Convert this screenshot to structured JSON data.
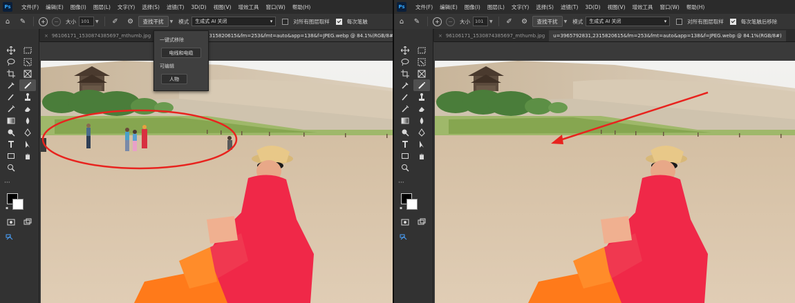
{
  "menu": {
    "app_icon": "Ps",
    "items": [
      "文件(F)",
      "编辑(E)",
      "图像(I)",
      "图层(L)",
      "文字(Y)",
      "选择(S)",
      "滤镜(T)",
      "3D(D)",
      "视图(V)",
      "增效工具",
      "窗口(W)",
      "帮助(H)"
    ]
  },
  "options": {
    "size_label": "大小",
    "size_value": "101",
    "find_button": "查找干扰",
    "mode_label": "模式",
    "mode_value": "生成式 AI 关闭",
    "sample_all_label": "对所有图层取样",
    "stroke_label": "每次笔触后移除",
    "stroke_label_short": "每次笔触"
  },
  "dropdown": {
    "heading1": "一键式移除",
    "button1": "电线和电缆",
    "heading2": "可编辑",
    "button2": "人物"
  },
  "left_doc": {
    "tab1": "96106171_1530874385697_mthumb.jpg",
    "tab2": "u=3965792831,2315820615&fm=253&fmt=auto&app=138&f=JPEG.webp @ 84.1%(RGB/8#)"
  },
  "right_doc": {
    "tab1": "96106171_1530874385697_mthumb.jpg",
    "tab2": "u=3965792831,2315820615&fm=253&fmt=auto&app=138&f=JPEG.webp @ 84.1%(RGB/8#)"
  },
  "annotations": {
    "left": "red-ellipse-around-people",
    "right": "red-arrow-pointing-to-cleared-area",
    "color": "#e8231e"
  },
  "tools": [
    "move-icon",
    "marquee-icon",
    "lasso-icon",
    "object-select-icon",
    "crop-icon",
    "frame-icon",
    "eyedropper-icon",
    "remove-tool-icon",
    "brush-icon",
    "stamp-icon",
    "history-brush-icon",
    "eraser-icon",
    "gradient-icon",
    "blur-icon",
    "dodge-icon",
    "pen-icon",
    "type-icon",
    "path-select-icon",
    "rectangle-icon",
    "hand-icon",
    "zoom-icon"
  ],
  "colors": {
    "foreground": "#000000",
    "background": "#ffffff",
    "dress": "#f02848",
    "pants": "#ff7a1a",
    "sand": "#d9c4a8",
    "sky": "#eef0f2"
  }
}
